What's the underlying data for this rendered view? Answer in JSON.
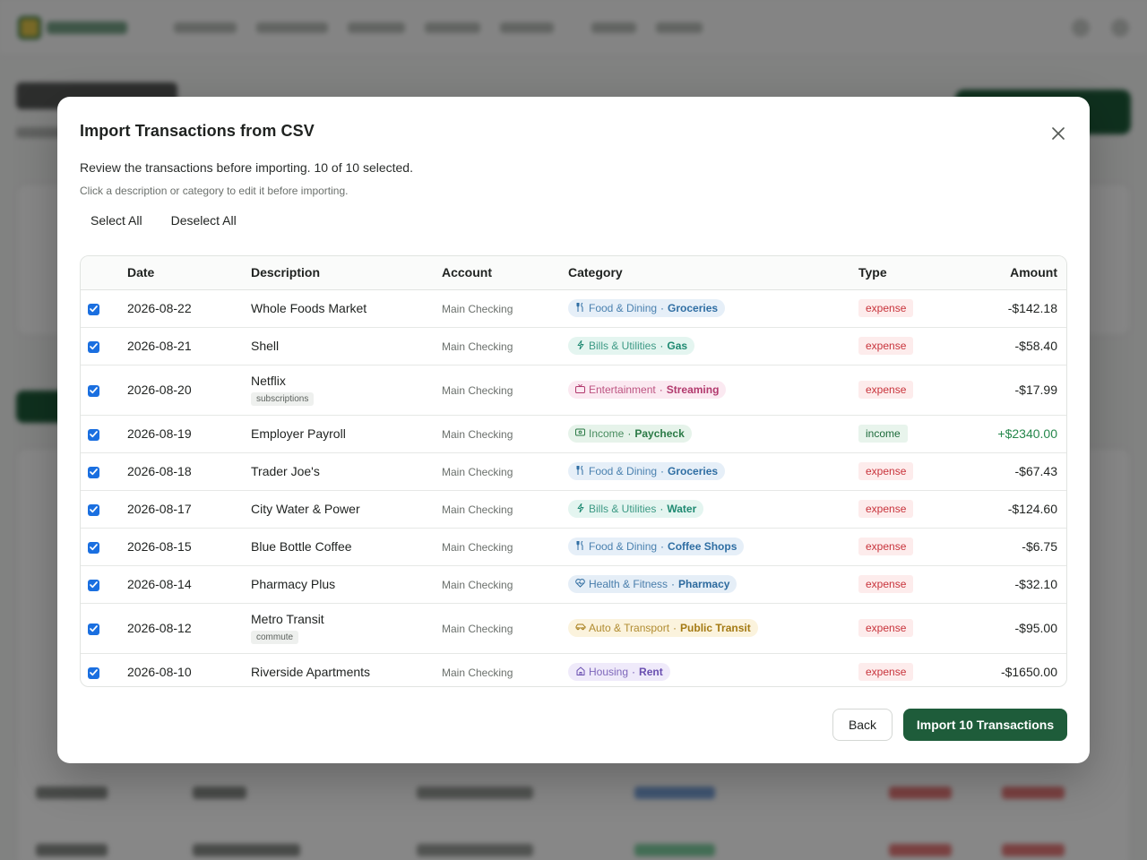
{
  "modal": {
    "title": "Import Transactions from CSV",
    "description": "Review the transactions before importing. 10 of 10 selected.",
    "hint": "Click a description or category to edit it before importing.",
    "select_all_label": "Select All",
    "deselect_all_label": "Deselect All",
    "back_label": "Back",
    "import_label": "Import 10 Transactions"
  },
  "table": {
    "headers": {
      "date": "Date",
      "description": "Description",
      "account": "Account",
      "category": "Category",
      "type": "Type",
      "amount": "Amount"
    },
    "rows": [
      {
        "checked": true,
        "date": "2026-08-22",
        "description": "Whole Foods Market",
        "tag": "",
        "account": "Main Checking",
        "category": "Food & Dining",
        "subcategory": "Groceries",
        "cat_icon": "utensils-icon",
        "cat_color": "#2f6ea3",
        "cat_bg": "#e6eff8",
        "type": "expense",
        "amount": "-$142.18"
      },
      {
        "checked": true,
        "date": "2026-08-21",
        "description": "Shell",
        "tag": "",
        "account": "Main Checking",
        "category": "Bills & Utilities",
        "subcategory": "Gas",
        "cat_icon": "bolt-icon",
        "cat_color": "#1f8a72",
        "cat_bg": "#e4f5f0",
        "type": "expense",
        "amount": "-$58.40"
      },
      {
        "checked": true,
        "date": "2026-08-20",
        "description": "Netflix",
        "tag": "subscriptions",
        "account": "Main Checking",
        "category": "Entertainment",
        "subcategory": "Streaming",
        "cat_icon": "tv-icon",
        "cat_color": "#b23a6e",
        "cat_bg": "#fbe9f1",
        "type": "expense",
        "amount": "-$17.99"
      },
      {
        "checked": true,
        "date": "2026-08-19",
        "description": "Employer Payroll",
        "tag": "",
        "account": "Main Checking",
        "category": "Income",
        "subcategory": "Paycheck",
        "cat_icon": "banknote-icon",
        "cat_color": "#2b7a46",
        "cat_bg": "#e6f3ea",
        "type": "income",
        "amount": "+$2340.00"
      },
      {
        "checked": true,
        "date": "2026-08-18",
        "description": "Trader Joe's",
        "tag": "",
        "account": "Main Checking",
        "category": "Food & Dining",
        "subcategory": "Groceries",
        "cat_icon": "utensils-icon",
        "cat_color": "#2f6ea3",
        "cat_bg": "#e6eff8",
        "type": "expense",
        "amount": "-$67.43"
      },
      {
        "checked": true,
        "date": "2026-08-17",
        "description": "City Water & Power",
        "tag": "",
        "account": "Main Checking",
        "category": "Bills & Utilities",
        "subcategory": "Water",
        "cat_icon": "bolt-icon",
        "cat_color": "#1f8a72",
        "cat_bg": "#e4f5f0",
        "type": "expense",
        "amount": "-$124.60"
      },
      {
        "checked": true,
        "date": "2026-08-15",
        "description": "Blue Bottle Coffee",
        "tag": "",
        "account": "Main Checking",
        "category": "Food & Dining",
        "subcategory": "Coffee Shops",
        "cat_icon": "utensils-icon",
        "cat_color": "#2f6ea3",
        "cat_bg": "#e6eff8",
        "type": "expense",
        "amount": "-$6.75"
      },
      {
        "checked": true,
        "date": "2026-08-14",
        "description": "Pharmacy Plus",
        "tag": "",
        "account": "Main Checking",
        "category": "Health & Fitness",
        "subcategory": "Pharmacy",
        "cat_icon": "heart-icon",
        "cat_color": "#2d6a9e",
        "cat_bg": "#e5eef7",
        "type": "expense",
        "amount": "-$32.10"
      },
      {
        "checked": true,
        "date": "2026-08-12",
        "description": "Metro Transit",
        "tag": "commute",
        "account": "Main Checking",
        "category": "Auto & Transport",
        "subcategory": "Public Transit",
        "cat_icon": "car-icon",
        "cat_color": "#a47a13",
        "cat_bg": "#fbf3dd",
        "type": "expense",
        "amount": "-$95.00"
      },
      {
        "checked": true,
        "date": "2026-08-10",
        "description": "Riverside Apartments",
        "tag": "",
        "account": "Main Checking",
        "category": "Housing",
        "subcategory": "Rent",
        "cat_icon": "home-icon",
        "cat_color": "#6a4fb0",
        "cat_bg": "#efeafa",
        "type": "expense",
        "amount": "-$1650.00"
      }
    ]
  },
  "colors": {
    "primary": "#1e5c3a",
    "checkbox": "#1a6fe0",
    "expense_text": "#c8333b",
    "income_text": "#26874c"
  }
}
